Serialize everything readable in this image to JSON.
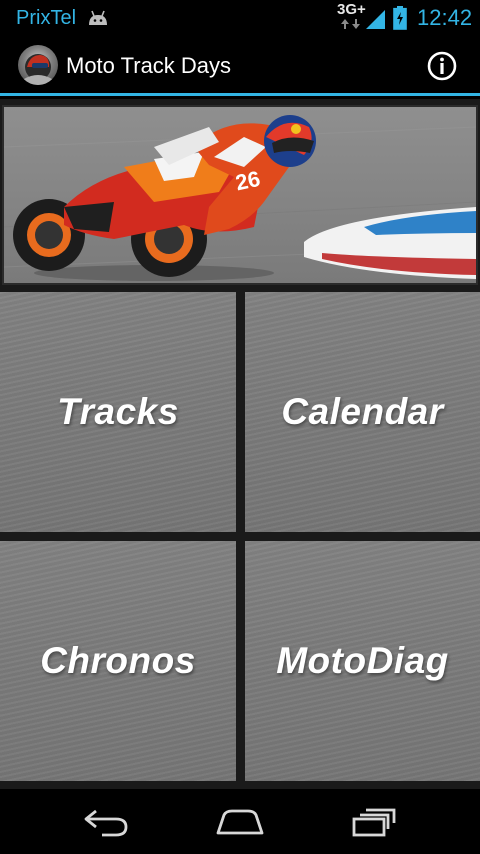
{
  "status_bar": {
    "carrier": "PrixTel",
    "network": "3G+",
    "time": "12:42",
    "icons": [
      "android-debug-icon",
      "signal-icon",
      "battery-charging-icon"
    ]
  },
  "action_bar": {
    "title": "Moto Track Days",
    "app_icon": "rider-helmet-avatar",
    "info_icon": "info-icon"
  },
  "hero": {
    "image": "motorcycle-racer-on-track",
    "bike_number": "26"
  },
  "tiles": [
    {
      "label": "Tracks"
    },
    {
      "label": "Calendar"
    },
    {
      "label": "Chronos"
    },
    {
      "label": "MotoDiag"
    }
  ],
  "nav_bar": {
    "buttons": [
      "back-icon",
      "home-icon",
      "recent-apps-icon"
    ]
  },
  "colors": {
    "accent": "#33b5e5",
    "tile_text": "#ffffff",
    "background": "#000000"
  }
}
